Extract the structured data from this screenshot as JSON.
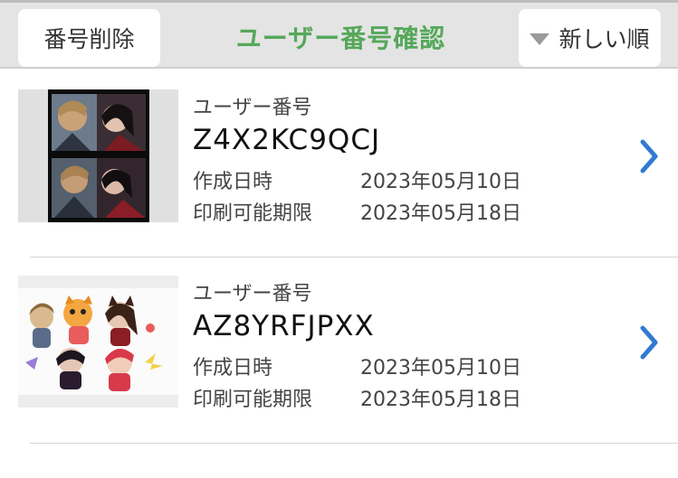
{
  "header": {
    "delete_label": "番号削除",
    "title": "ユーザー番号確認",
    "sort_label": "新しい順",
    "title_color": "#55a85a"
  },
  "items": [
    {
      "number_label": "ユーザー番号",
      "user_number": "Z4X2KC9QCJ",
      "created_label": "作成日時",
      "created_value": "2023年05月10日",
      "deadline_label": "印刷可能期限",
      "deadline_value": "2023年05月18日"
    },
    {
      "number_label": "ユーザー番号",
      "user_number": "AZ8YRFJPXX",
      "created_label": "作成日時",
      "created_value": "2023年05月10日",
      "deadline_label": "印刷可能期限",
      "deadline_value": "2023年05月18日"
    }
  ],
  "icons": {
    "sort": "triangle-down-icon",
    "row_arrow": "chevron-right-icon"
  },
  "accent_color": "#2f7bd0"
}
